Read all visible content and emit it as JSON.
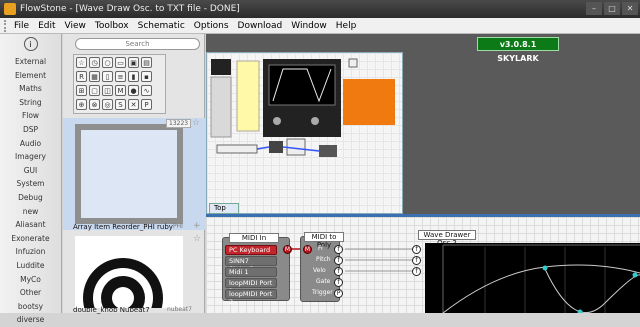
{
  "window": {
    "title": "FlowStone - [Wave Draw Osc. to TXT file - DONE]",
    "controls": [
      "–",
      "□",
      "✕"
    ]
  },
  "menu": [
    "File",
    "Edit",
    "View",
    "Toolbox",
    "Schematic",
    "Options",
    "Download",
    "Window",
    "Help"
  ],
  "sidebar": {
    "top_icon": "i",
    "categories": [
      "External",
      "Element",
      "Maths",
      "String",
      "Flow",
      "DSP",
      "Audio",
      "Imagery",
      "GUI",
      "System",
      "Debug",
      "new",
      "Aliasant",
      "Exonerate",
      "Infuzion",
      "Luddite",
      "MyCo",
      "Other",
      "bootsy",
      "diverse"
    ]
  },
  "toolbox": {
    "search_placeholder": "Search",
    "filter_icons": [
      "star-icon",
      "clock-icon",
      "circle-icon",
      "rect-icon",
      "image-icon",
      "layers-icon",
      "r-icon",
      "grid-icon",
      "doc-icon",
      "list-icon",
      "bar-icon",
      "chip-icon",
      "connector-icon",
      "page-icon",
      "tile-icon",
      "m-icon",
      "dot-icon",
      "wave-icon",
      "arrow-icon",
      "cross-icon",
      "ring-icon",
      "s-icon",
      "x-icon",
      "p-icon"
    ],
    "items": [
      {
        "id": "13223",
        "name": "Array Item Reorder_PHI ruby",
        "author": "PHI"
      },
      {
        "id": "",
        "name": "double_knob Nubeat7",
        "author": "nubeat7"
      }
    ]
  },
  "version_badge": "v3.0.8.1 SKYLARK",
  "top_tab": "Top",
  "modules": {
    "midi_in": {
      "title": "MIDI In",
      "rows": [
        "PC Keyboard",
        "SINN7 Status2...",
        "Midi 1",
        "loopMIDI Port 1",
        "loopMIDI Port 2"
      ]
    },
    "midi_to_poly": {
      "title": "MIDI to Poly",
      "outputs": [
        "Fr",
        "Pitch",
        "Velo",
        "Gate",
        "Trigger"
      ]
    },
    "wave_drawer": {
      "title": "Wave Drawer Osc 2"
    }
  },
  "pins": {
    "m": "M",
    "f": "f",
    "p": "P"
  },
  "colors": {
    "accent": "#3a6fb0",
    "version_bg": "#0c7a16",
    "selected_device": "#c0262c",
    "sticky_note": "#fff9a8",
    "warning_note": "#f07a10"
  }
}
